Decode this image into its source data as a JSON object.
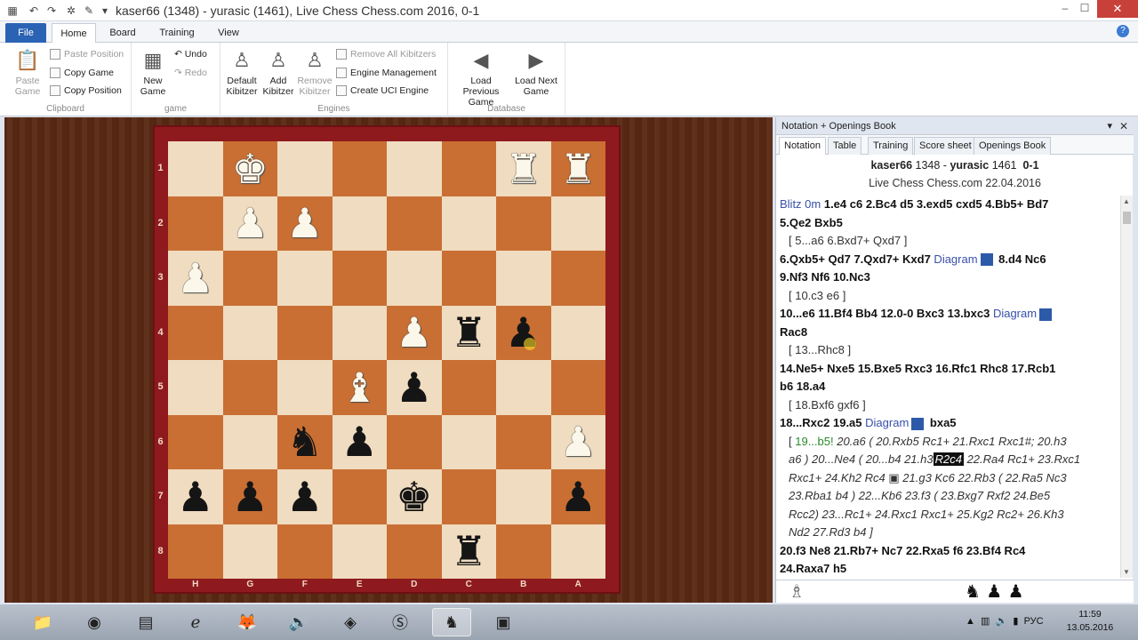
{
  "window": {
    "title": "kaser66 (1348) - yurasic (1461), Live Chess Chess.com 2016, 0-1",
    "min": "–",
    "max": "☐",
    "close": "✕"
  },
  "tabs": [
    "File",
    "Home",
    "Board",
    "Training",
    "View"
  ],
  "help": "?",
  "ribbon": {
    "clipboard": {
      "label": "Clipboard",
      "paste_game": "Paste Game",
      "paste_position": "Paste Position",
      "copy_game": "Copy Game",
      "copy_position": "Copy Position"
    },
    "game": {
      "label": "game",
      "new_game": "New Game",
      "undo": "Undo",
      "redo": "Redo"
    },
    "engines": {
      "label": "Engines",
      "default_kibitzer": "Default Kibitzer",
      "add_kibitzer": "Add Kibitzer",
      "remove_kibitzer": "Remove Kibitzer",
      "remove_all_kibitzers": "Remove All Kibitzers",
      "engine_management": "Engine Management",
      "create_uci_engine": "Create UCI Engine"
    },
    "database": {
      "label": "Database",
      "load_previous": "Load Previous Game",
      "load_next": "Load Next Game"
    }
  },
  "board": {
    "ranks": [
      "1",
      "2",
      "3",
      "4",
      "5",
      "6",
      "7",
      "8"
    ],
    "files": [
      "H",
      "G",
      "F",
      "E",
      "D",
      "C",
      "B",
      "A"
    ],
    "squares": [
      [
        "",
        "wK",
        "",
        "",
        "",
        "",
        "wR",
        "wR"
      ],
      [
        "",
        "wP",
        "wP",
        "",
        "",
        "",
        "",
        ""
      ],
      [
        "wP",
        "",
        "",
        "",
        "",
        "",
        "",
        ""
      ],
      [
        "",
        "",
        "",
        "",
        "wP",
        "bR",
        "bP",
        ""
      ],
      [
        "",
        "",
        "",
        "wB",
        "bP",
        "",
        "",
        ""
      ],
      [
        "",
        "",
        "bN",
        "bP",
        "",
        "",
        "",
        "wP"
      ],
      [
        "bP",
        "bP",
        "bP",
        "",
        "bK",
        "",
        "",
        "bP"
      ],
      [
        "",
        "",
        "",
        "",
        "",
        "bR",
        "",
        ""
      ]
    ]
  },
  "panel": {
    "title": "Notation + Openings Book",
    "close": "✕",
    "tabs": [
      "Notation",
      "Table",
      "Training",
      "Score sheet",
      "Openings Book"
    ],
    "white": "kaser66",
    "white_elo": "1348",
    "black": "yurasic",
    "black_elo": "1461",
    "result": "0-1",
    "event_line": "Live Chess Chess.com 22.04.2016",
    "lines": [
      "Blitz 0m|1.e4 c6 2.Bc4 d5 3.exd5 cxd5 4.Bb5+ Bd7",
      "5.Qe2 Bxb5",
      "[ 5...a6 6.Bxd7+ Qxd7 ]",
      "6.Qxb5+ Qd7 7.Qxd7+ Kxd7|Diagram|8.d4 Nc6",
      "9.Nf3 Nf6 10.Nc3",
      "[ 10.c3 e6 ]",
      "10...e6 11.Bf4 Bb4 12.0-0 Bxc3 13.bxc3|Diagram",
      "Rac8",
      "[ 13...Rhc8 ]",
      "14.Ne5+ Nxe5 15.Bxe5 Rxc3 16.Rfc1 Rhc8 17.Rcb1",
      "b6 18.a4",
      "[ 18.Bxf6 gxf6 ]",
      "18...Rxc2 19.a5|Diagram|bxa5",
      "[ 19...b5!|20.a6 ( 20.Rxb5 Rc1+ 21.Rxc1 Rxc1#; 20.h3",
      "a6 ) 20...Ne4 ( 20...b4 21.h3|R2c4|22.Ra4 Rc1+ 23.Rxc1",
      "Rxc1+ 24.Kh2 Rc4|21.g3 Kc6 22.Rb3 ( 22.Ra5 Nc3",
      "23.Rba1 b4 ) 22...Kb6 23.f3 ( 23.Bxg7 Rxf2 24.Be5",
      "Rcc2) 23...Rc1+ 24.Rxc1 Rxc1+ 25.Kg2 Rc2+ 26.Kh3",
      "Nd2 27.Rd3 b4 ]",
      "20.f3 Ne8 21.Rb7+ Nc7 22.Rxa5 f6 23.Bf4 Rc4",
      "24.Raxa7 h5"
    ],
    "material_white": "♗",
    "material_black": "♞ ♟ ♟"
  },
  "taskbar": {
    "lang": "РУС",
    "time": "11:59",
    "date": "13.05.2016"
  }
}
